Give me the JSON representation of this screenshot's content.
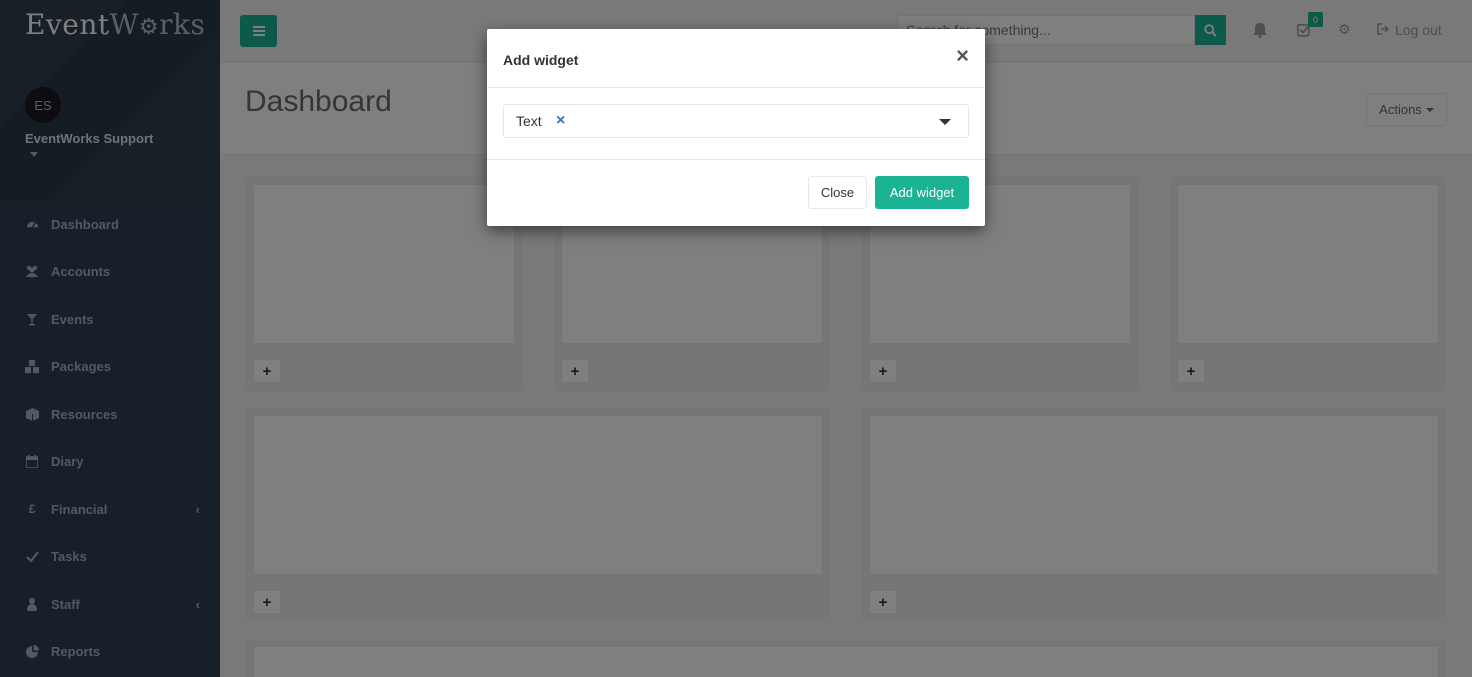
{
  "app": {
    "logo_part1": "Event",
    "logo_part2": "W",
    "logo_part3": "rks"
  },
  "profile": {
    "initials": "ES",
    "name": "EventWorks Support"
  },
  "sidebar": {
    "items": [
      {
        "label": "Dashboard",
        "icon": "dashboard-icon"
      },
      {
        "label": "Accounts",
        "icon": "users-icon"
      },
      {
        "label": "Events",
        "icon": "glass-icon"
      },
      {
        "label": "Packages",
        "icon": "cubes-icon"
      },
      {
        "label": "Resources",
        "icon": "cube-icon"
      },
      {
        "label": "Diary",
        "icon": "calendar-icon"
      },
      {
        "label": "Financial",
        "icon": "pound-icon",
        "arrow": "‹"
      },
      {
        "label": "Tasks",
        "icon": "check-icon"
      },
      {
        "label": "Staff",
        "icon": "user-icon",
        "arrow": "‹"
      },
      {
        "label": "Reports",
        "icon": "pie-chart-icon"
      }
    ]
  },
  "topbar": {
    "search_placeholder": "Search for something...",
    "tasks_badge": "0",
    "logout_label": "Log out"
  },
  "page": {
    "title": "Dashboard",
    "actions_label": "Actions"
  },
  "modal": {
    "title": "Add widget",
    "close_symbol": "×",
    "selected_value": "Text",
    "clear_symbol": "×",
    "close_label": "Close",
    "add_label": "Add widget"
  },
  "widget_add_symbol": "+",
  "colors": {
    "primary": "#1ab394",
    "sidebar": "#2f4050"
  }
}
